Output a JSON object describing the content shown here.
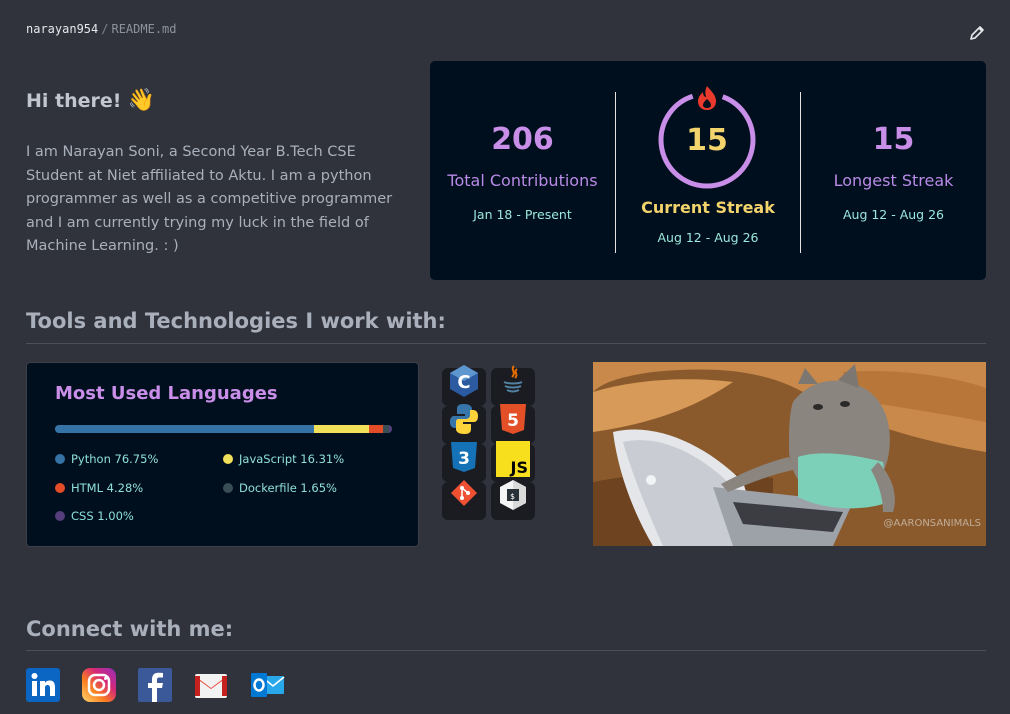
{
  "breadcrumb": {
    "user": "narayan954",
    "separator": "/",
    "file": "README.md"
  },
  "greeting": {
    "text": "Hi there!",
    "emoji": "👋"
  },
  "intro": "I am Narayan Soni, a Second Year B.Tech CSE Student at Niet affiliated to Aktu. I am a python programmer as well as a competitive programmer and I am currently trying my luck in the field of Machine Learning. : )",
  "streak": {
    "total": {
      "value": "206",
      "label": "Total Contributions",
      "range": "Jan 18 - Present"
    },
    "current": {
      "value": "15",
      "label": "Current Streak",
      "range": "Aug 12 - Aug 26"
    },
    "longest": {
      "value": "15",
      "label": "Longest Streak",
      "range": "Aug 12 - Aug 26"
    }
  },
  "sections": {
    "tools": "Tools and Technologies I work with:",
    "connect": "Connect with me:"
  },
  "languages": {
    "title": "Most Used Languages",
    "items": [
      {
        "name": "Python",
        "percent": 76.75,
        "text": "Python 76.75%",
        "color": "#3572A5"
      },
      {
        "name": "JavaScript",
        "percent": 16.31,
        "text": "JavaScript 16.31%",
        "color": "#f1e05a"
      },
      {
        "name": "HTML",
        "percent": 4.28,
        "text": "HTML 4.28%",
        "color": "#e34c26"
      },
      {
        "name": "Dockerfile",
        "percent": 1.65,
        "text": "Dockerfile 1.65%",
        "color": "#384d54"
      },
      {
        "name": "CSS",
        "percent": 1.0,
        "text": "CSS 1.00%",
        "color": "#563d7c"
      }
    ]
  },
  "tools": [
    "c-icon",
    "java-icon",
    "python-icon",
    "html5-icon",
    "css3-icon",
    "javascript-icon",
    "git-icon",
    "bash-icon"
  ],
  "gif": {
    "watermark": "@AARONSANIMALS"
  },
  "socials": [
    "linkedin-icon",
    "instagram-icon",
    "facebook-icon",
    "gmail-icon",
    "outlook-icon"
  ]
}
